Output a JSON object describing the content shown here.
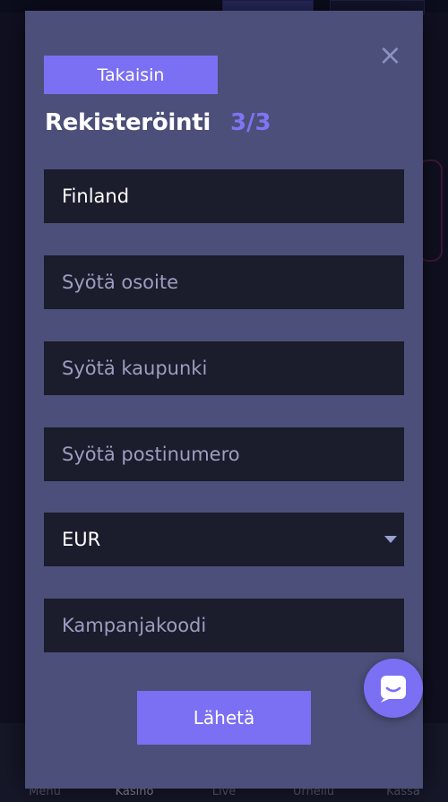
{
  "nav": {
    "items": [
      "Menu",
      "Kasino",
      "Live",
      "Urheilu",
      "Kassa"
    ],
    "active": "Kasino"
  },
  "modal": {
    "back_label": "Takaisin",
    "title": "Rekisteröinti",
    "step": "3/3",
    "close_icon": "close-icon",
    "country_value": "Finland",
    "address_placeholder": "Syötä osoite",
    "city_placeholder": "Syötä kaupunki",
    "postal_placeholder": "Syötä postinumero",
    "currency_value": "EUR",
    "promo_placeholder": "Kampanjakoodi",
    "submit_label": "Lähetä"
  },
  "chat": {
    "icon": "chat-icon"
  },
  "colors": {
    "accent": "#7b6ff3",
    "modal_bg": "#4c4f79",
    "field_bg": "#1b1c2c",
    "step_color": "#7f74f2"
  }
}
